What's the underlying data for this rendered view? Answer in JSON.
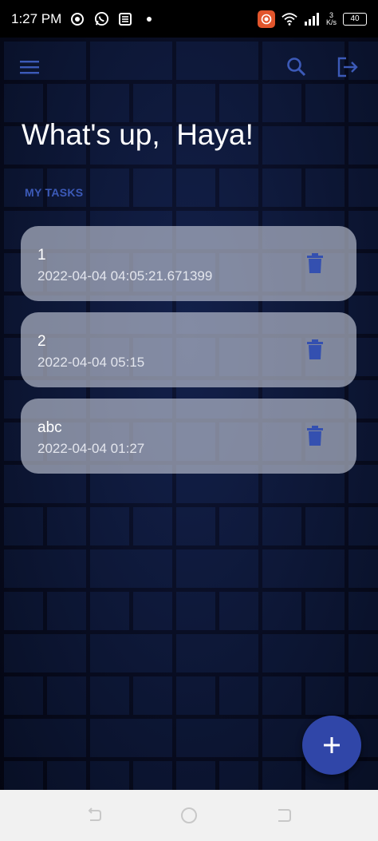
{
  "status_bar": {
    "time": "1:27 PM",
    "net_speed_value": "3",
    "net_speed_unit": "K/s",
    "battery": "40"
  },
  "app_bar": {
    "icons": [
      "menu-icon",
      "search-icon",
      "logout-icon"
    ]
  },
  "greeting": "What's up,  Haya!",
  "section_label": "MY TASKS",
  "tasks": [
    {
      "title": "1",
      "date": "2022-04-04 04:05:21.671399"
    },
    {
      "title": "2",
      "date": "2022-04-04 05:15"
    },
    {
      "title": "abc",
      "date": "2022-04-04 01:27"
    }
  ],
  "colors": {
    "accent": "#3046a8",
    "label": "#3c5ab8",
    "card": "#c8cddc"
  }
}
